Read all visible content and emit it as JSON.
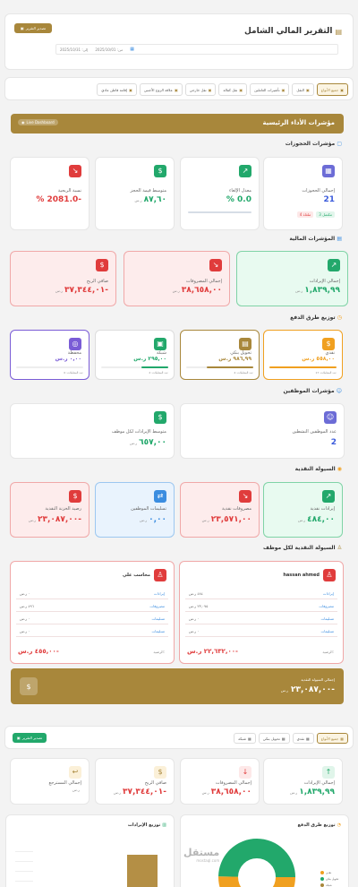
{
  "header": {
    "title": "التقرير المالي الشامل",
    "export_label": "تصدير التقرير",
    "date_from": "من: 2025/10/01",
    "date_to": "إلى: 2025/10/31"
  },
  "filters": {
    "tabs": [
      "جميع الأنواع",
      "النقل",
      "تأشيرات العاملين",
      "نقل كفالة",
      "نقل خارجي",
      "علاقة الزوج الأجنبي",
      "إقامة قاطن عادي"
    ]
  },
  "kpi": {
    "title": "مؤشرات الأداء الرئيسية",
    "badge": "Live Dashboard"
  },
  "bookings": {
    "title": "مؤشرات الحجوزات",
    "cards": [
      {
        "label": "إجمالي الحجوزات",
        "value": "21",
        "tag1": "مكتمل 3",
        "tag2": "ملغاة 4"
      },
      {
        "label": "معدل الإلغاء",
        "value": "0.0 %",
        "sub": ""
      },
      {
        "label": "متوسط قيمة الحجز",
        "value": "٨٧,٦٠",
        "sub": "ر.س"
      },
      {
        "label": "نسبة الربحية",
        "value": "-2081.0 %",
        "sub": ""
      }
    ]
  },
  "finance": {
    "title": "المؤشرات المالية",
    "cards": [
      {
        "label": "إجمالي الإيرادات",
        "value": "١,٨٣٩,٩٩",
        "sub": "ر.س"
      },
      {
        "label": "إجمالي المصروفات",
        "value": "٣٨,٦٥٨,٠٠",
        "sub": "ر.س"
      },
      {
        "label": "صافي الربح",
        "value": "-٣٧,٣٤٤,٠١",
        "sub": "ر.س"
      }
    ]
  },
  "payments": {
    "title": "توزيع طرق الدفع",
    "cards": [
      {
        "label": "نقدي",
        "value": "٥٥٨,٠٠ ر.س",
        "count": "عدد المعاملات: 17"
      },
      {
        "label": "تحويل بنكي",
        "value": "٩٨٦,٩٩ ر.س",
        "count": "عدد المعاملات: 4"
      },
      {
        "label": "شبكة",
        "value": "٢٩٥,٠٠ ر.س",
        "count": "عدد المعاملات: 2"
      },
      {
        "label": "محفظة",
        "value": "٠,٠٠ ر.س",
        "count": "عدد المعاملات: 0"
      }
    ]
  },
  "employees": {
    "title": "مؤشرات الموظفين",
    "cards": [
      {
        "label": "عدد الموظفين النشطين",
        "value": "2"
      },
      {
        "label": "متوسط الإيرادات لكل موظف",
        "value": "٦٥٧,٠٠",
        "sub": "ر.س"
      }
    ]
  },
  "cash": {
    "title": "السيولة النقدية",
    "cards": [
      {
        "label": "إيرادات نقدية",
        "value": "٤٨٤,٠٠",
        "sub": "ر.س"
      },
      {
        "label": "مصروفات نقدية",
        "value": "٢٣,٥٧١,٠٠",
        "sub": "ر.س"
      },
      {
        "label": "تسليمات الموظفين",
        "value": "٠,٠٠",
        "sub": "ر.س"
      },
      {
        "label": "رصيد الخزنة النقدية",
        "value": "-٢٣,٠٨٧,٠٠",
        "sub": "ر.س"
      }
    ]
  },
  "cash_employee": {
    "title": "السيولة النقدية لكل موظف",
    "employees": [
      {
        "name": "hassan ahmed",
        "rows": [
          [
            "إيرادات",
            "٤٨٤ ر.س"
          ],
          [
            "مصروفات",
            "٢٣,٠٧٥ ر.س"
          ],
          [
            "تسليمات",
            "٠ ر.س"
          ],
          [
            "تسليمات",
            "٠ ر.س"
          ]
        ],
        "total_label": "الرصيد:",
        "total": "-٢٢,٦٣٢,٠٠ ر.س"
      },
      {
        "name": "محاسب علي",
        "rows": [
          [
            "إيرادات",
            "٠ ر.س"
          ],
          [
            "مصروفات",
            "٤٩٦ ر.س"
          ],
          [
            "تسليمات",
            "٠ ر.س"
          ],
          [
            "تسليمات",
            "٠ ر.س"
          ]
        ],
        "total_label": "الرصيد:",
        "total": "-٤٥٥,٠٠ ر.س"
      }
    ],
    "summary_label": "إجمالي السيولة النقدية",
    "summary_value": "-٢٣,٠٨٧,٠٠",
    "summary_sub": "ر.س"
  },
  "bottom": {
    "tabs": [
      "جميع الأنواع",
      "نقدي",
      "تحويل بنكي",
      "شبكة"
    ],
    "export_label": "تصدير التقرير",
    "cards": [
      {
        "label": "إجمالي الإيرادات",
        "value": "١,٨٣٩,٩٩",
        "sub": "ر.س"
      },
      {
        "label": "إجمالي المصروفات",
        "value": "٣٨,٦٥٨,٠٠",
        "sub": "ر.س"
      },
      {
        "label": "صافي الربح",
        "value": "-٣٧,٣٤٤,٠١",
        "sub": "ر.س"
      },
      {
        "label": "إجمالي المسترجع",
        "value": "",
        "sub": "ر.س"
      }
    ],
    "chart_pay_title": "توزيع طرق الدفع",
    "chart_rev_title": "توزيع الإيرادات",
    "legend": [
      "نقدي",
      "تحويل بنكي",
      "شبكة"
    ]
  },
  "watermark": "مستقل",
  "watermark_sub": "mostaql.com",
  "colors": {
    "gold": "#a8873b",
    "green": "#22a86b",
    "red": "#e03c3c",
    "blue": "#3b8de0",
    "purple": "#7a5cd6",
    "orange": "#f0a020"
  }
}
